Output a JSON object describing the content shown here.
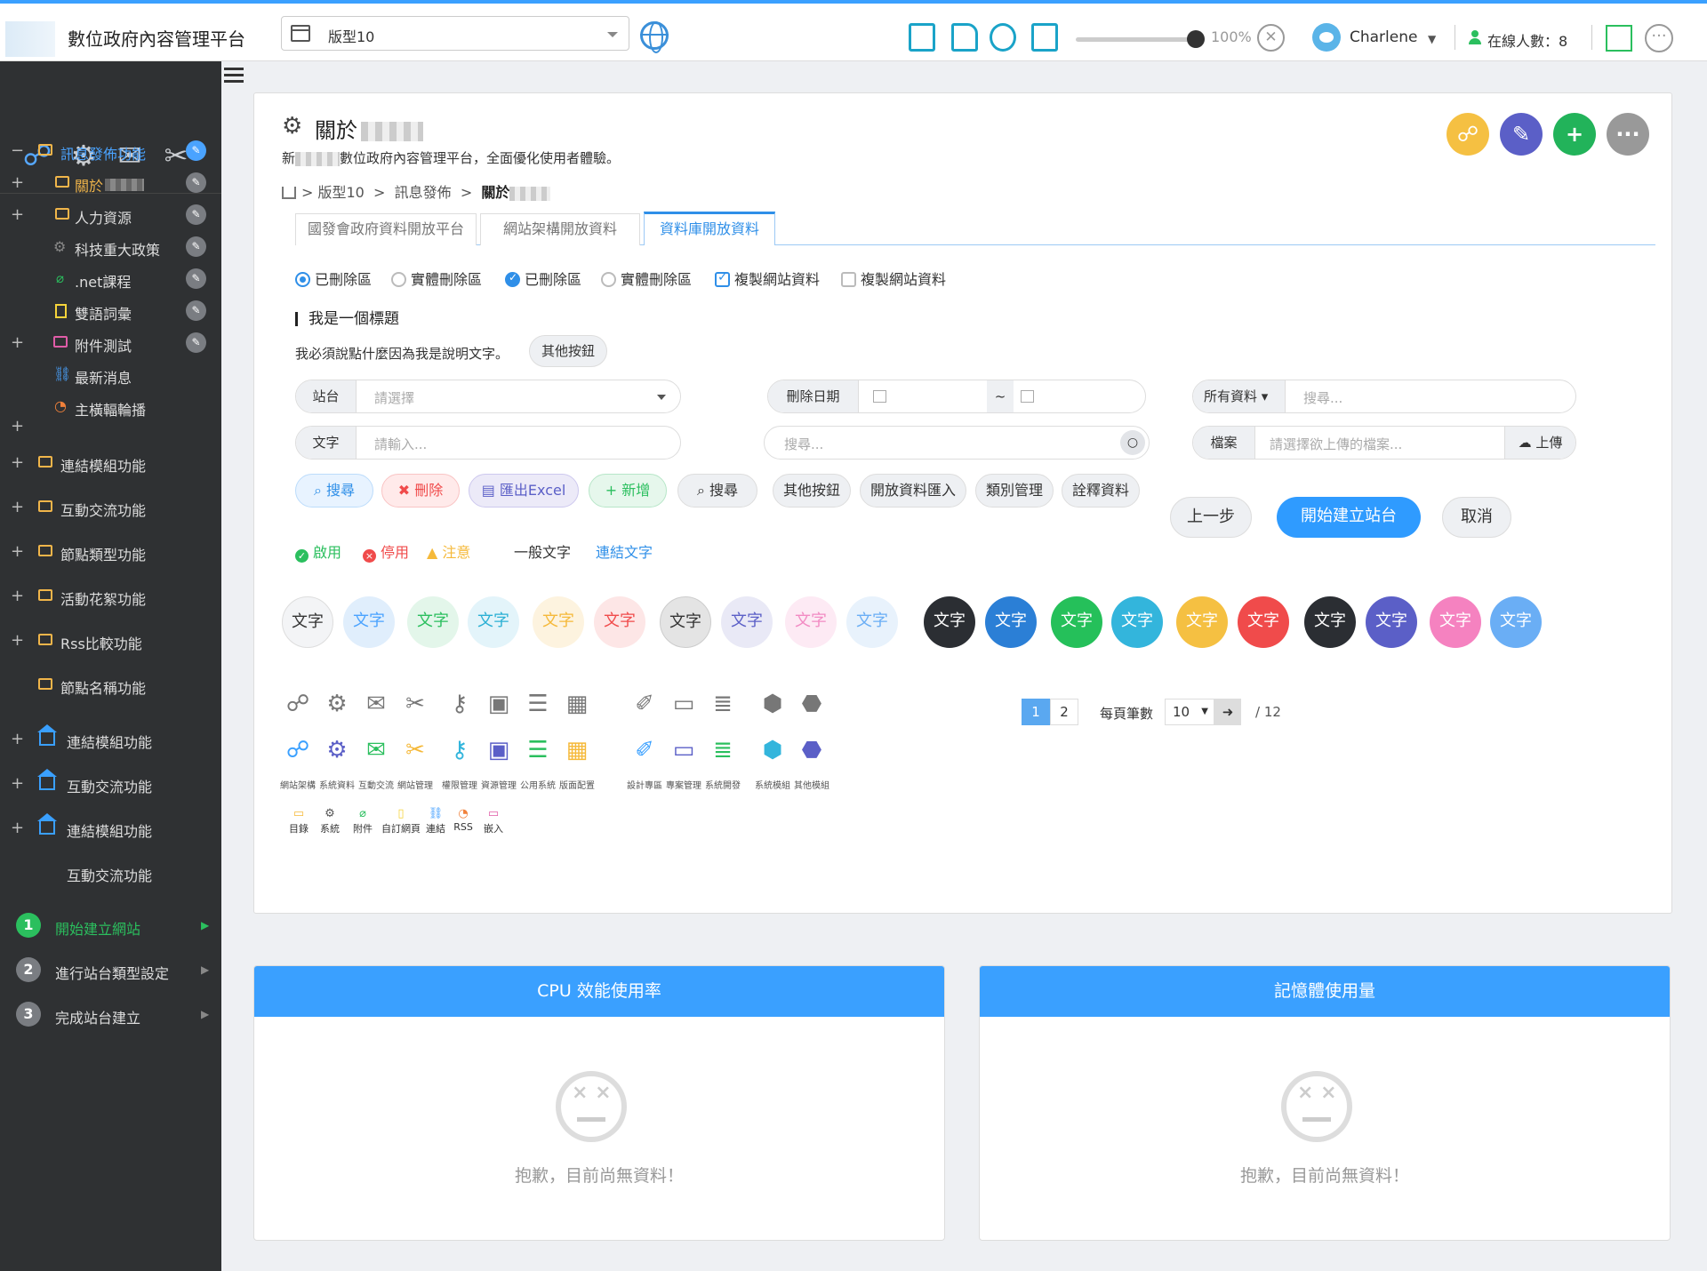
{
  "header": {
    "app_title": "數位政府內容管理平台",
    "version_value": "版型10",
    "zoom": "100%",
    "user": "Charlene",
    "online": "在線人數：8"
  },
  "sidebar": {
    "items": [
      {
        "pm": "−",
        "label": "訊息發佈功能"
      },
      {
        "pm": "+",
        "label": "關於"
      },
      {
        "pm": "+",
        "label": "人力資源"
      },
      {
        "pm": "",
        "label": "科技重大政策"
      },
      {
        "pm": "",
        "label": ".net課程"
      },
      {
        "pm": "",
        "label": "雙語詞彙"
      },
      {
        "pm": "+",
        "label": "附件測試"
      },
      {
        "pm": "",
        "label": "最新消息"
      },
      {
        "pm": "",
        "label": "主橫輻輪播"
      }
    ],
    "groups": [
      {
        "pm": "+",
        "label": "連結模組功能"
      },
      {
        "pm": "+",
        "label": "互動交流功能"
      },
      {
        "pm": "+",
        "label": "節點類型功能"
      },
      {
        "pm": "+",
        "label": "活動花絮功能"
      },
      {
        "pm": "+",
        "label": "Rss比較功能"
      },
      {
        "pm": "",
        "label": "節點名稱功能"
      },
      {
        "pm": "+",
        "label": "連結模組功能"
      },
      {
        "pm": "+",
        "label": "互動交流功能"
      },
      {
        "pm": "+",
        "label": "連結模組功能"
      },
      {
        "pm": "",
        "label": "互動交流功能"
      }
    ],
    "steps": [
      {
        "num": "1",
        "label": "開始建立網站"
      },
      {
        "num": "2",
        "label": "進行站台類型設定"
      },
      {
        "num": "3",
        "label": "完成站台建立"
      }
    ]
  },
  "panel": {
    "title": "關於",
    "desc_prefix": "新",
    "desc_suffix": "數位政府內容管理平台，全面優化使用者體驗。",
    "breadcrumb": [
      "版型10",
      "訊息發佈",
      "關於"
    ],
    "tabs": [
      "國發會政府資料開放平台",
      "網站架構開放資料",
      "資料庫開放資料"
    ],
    "options": [
      "已刪除區",
      "實體刪除區",
      "已刪除區",
      "實體刪除區",
      "複製網站資料",
      "複製網站資料"
    ],
    "section_title": "我是一個標題",
    "section_desc": "我必須說點什麼因為我是說明文字。",
    "other_button": "其他按鈕",
    "fields": {
      "site_label": "站台",
      "site_ph": "請選擇",
      "text_label": "文字",
      "text_ph": "請輸入...",
      "date_label": "刪除日期",
      "date_sep": "~",
      "search_ph": "搜尋...",
      "all_label": "所有資料",
      "all_ph": "搜尋...",
      "file_label": "檔案",
      "file_ph": "請選擇欲上傳的檔案...",
      "upload": "上傳"
    },
    "actions": [
      "搜尋",
      "刪除",
      "匯出Excel",
      "新增",
      "搜尋",
      "其他按鈕",
      "開放資料匯入",
      "類別管理",
      "詮釋資料"
    ],
    "big_buttons": [
      "上一步",
      "開始建立站台",
      "取消"
    ],
    "status": [
      "啟用",
      "停用",
      "注意",
      "一般文字",
      "連結文字"
    ],
    "bubble_text": "文字",
    "icon_labels": [
      "網站架構",
      "系統資料",
      "互動交流",
      "網站管理",
      "權限管理",
      "資源管理",
      "公用系統",
      "版面配置",
      "設計專區",
      "專案管理",
      "系統開發",
      "系統模組",
      "其他模組"
    ],
    "mini_labels": [
      "目錄",
      "系統",
      "附件",
      "自訂網頁",
      "連結",
      "RSS",
      "嵌入"
    ],
    "pager": {
      "pages": [
        "1",
        "2"
      ],
      "per_page_label": "每頁筆數",
      "per_page": "10",
      "total": "/ 12"
    }
  },
  "cards": [
    {
      "title": "CPU 效能使用率",
      "empty": "抱歉，目前尚無資料！"
    },
    {
      "title": "記憶體使用量",
      "empty": "抱歉，目前尚無資料！"
    }
  ],
  "colors": {
    "accent": "#3aa0ff",
    "green": "#2bbf5e",
    "red": "#f04b4b",
    "yellow": "#f5b93a"
  }
}
